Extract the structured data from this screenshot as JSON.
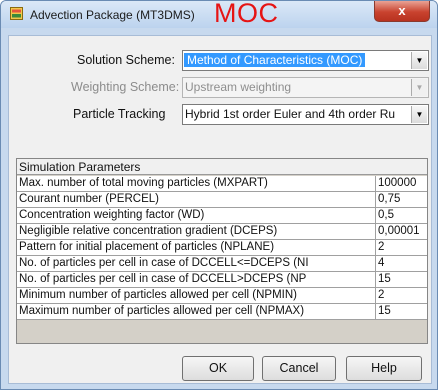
{
  "window": {
    "title": "Advection Package (MT3DMS)",
    "annotation": "MOC",
    "close_symbol": "x"
  },
  "form": {
    "solution_scheme": {
      "label": "Solution Scheme:",
      "value": "Method of Characteristics (MOC)"
    },
    "weighting_scheme": {
      "label": "Weighting Scheme:",
      "value": "Upstream weighting"
    },
    "particle_tracking": {
      "label": "Particle Tracking",
      "value": "Hybrid 1st order Euler and 4th order Ru"
    }
  },
  "grid": {
    "header": "Simulation Parameters",
    "rows": [
      {
        "name": "Max. number of total moving particles (MXPART)",
        "value": "100000"
      },
      {
        "name": "Courant number (PERCEL)",
        "value": "0,75"
      },
      {
        "name": "Concentration weighting factor (WD)",
        "value": "0,5"
      },
      {
        "name": "Negligible relative concentration gradient (DCEPS)",
        "value": "0,00001"
      },
      {
        "name": "Pattern for initial placement of particles (NPLANE)",
        "value": "2"
      },
      {
        "name": "No. of particles per cell in case of DCCELL<=DCEPS (NI",
        "value": "4"
      },
      {
        "name": "No. of particles per cell in case of DCCELL>DCEPS (NP",
        "value": "15"
      },
      {
        "name": "Minimum number of particles allowed per cell (NPMIN)",
        "value": "2"
      },
      {
        "name": "Maximum number of particles allowed per cell (NPMAX)",
        "value": "15"
      }
    ]
  },
  "buttons": {
    "ok": "OK",
    "cancel": "Cancel",
    "help": "Help"
  },
  "icons": {
    "app": "package-icon",
    "dropdown": "chevron-down-icon"
  },
  "colors": {
    "annotation": "#e61414",
    "selection": "#3399ff",
    "close": "#c9432f"
  }
}
